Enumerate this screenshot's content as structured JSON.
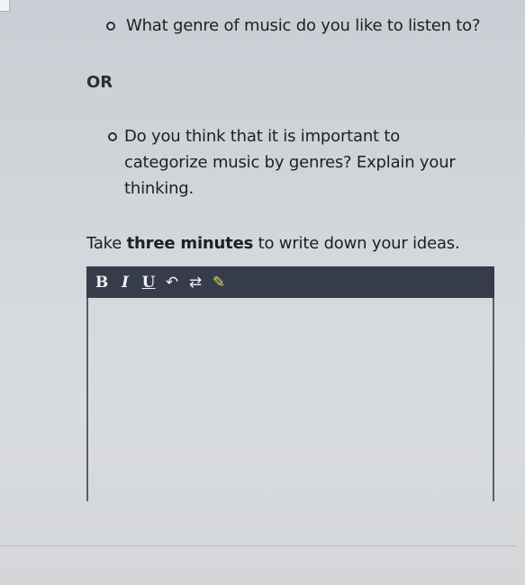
{
  "questions": [
    {
      "text": "What genre of music do you like to listen to?"
    },
    {
      "text": "Do you think that it is important to categorize music by genres? Explain your thinking."
    }
  ],
  "separator": "OR",
  "instructions": {
    "prefix": "Take ",
    "emphasis": "three minutes",
    "suffix": " to write down your ideas."
  },
  "toolbar": {
    "bold": "B",
    "italic": "I",
    "underline": "U",
    "undo": "↶",
    "redo": "⇄",
    "pencil": "✎"
  },
  "editor": {
    "value": ""
  },
  "colors": {
    "toolbar_bg": "#363c4a",
    "pencil": "#e5d36a"
  }
}
